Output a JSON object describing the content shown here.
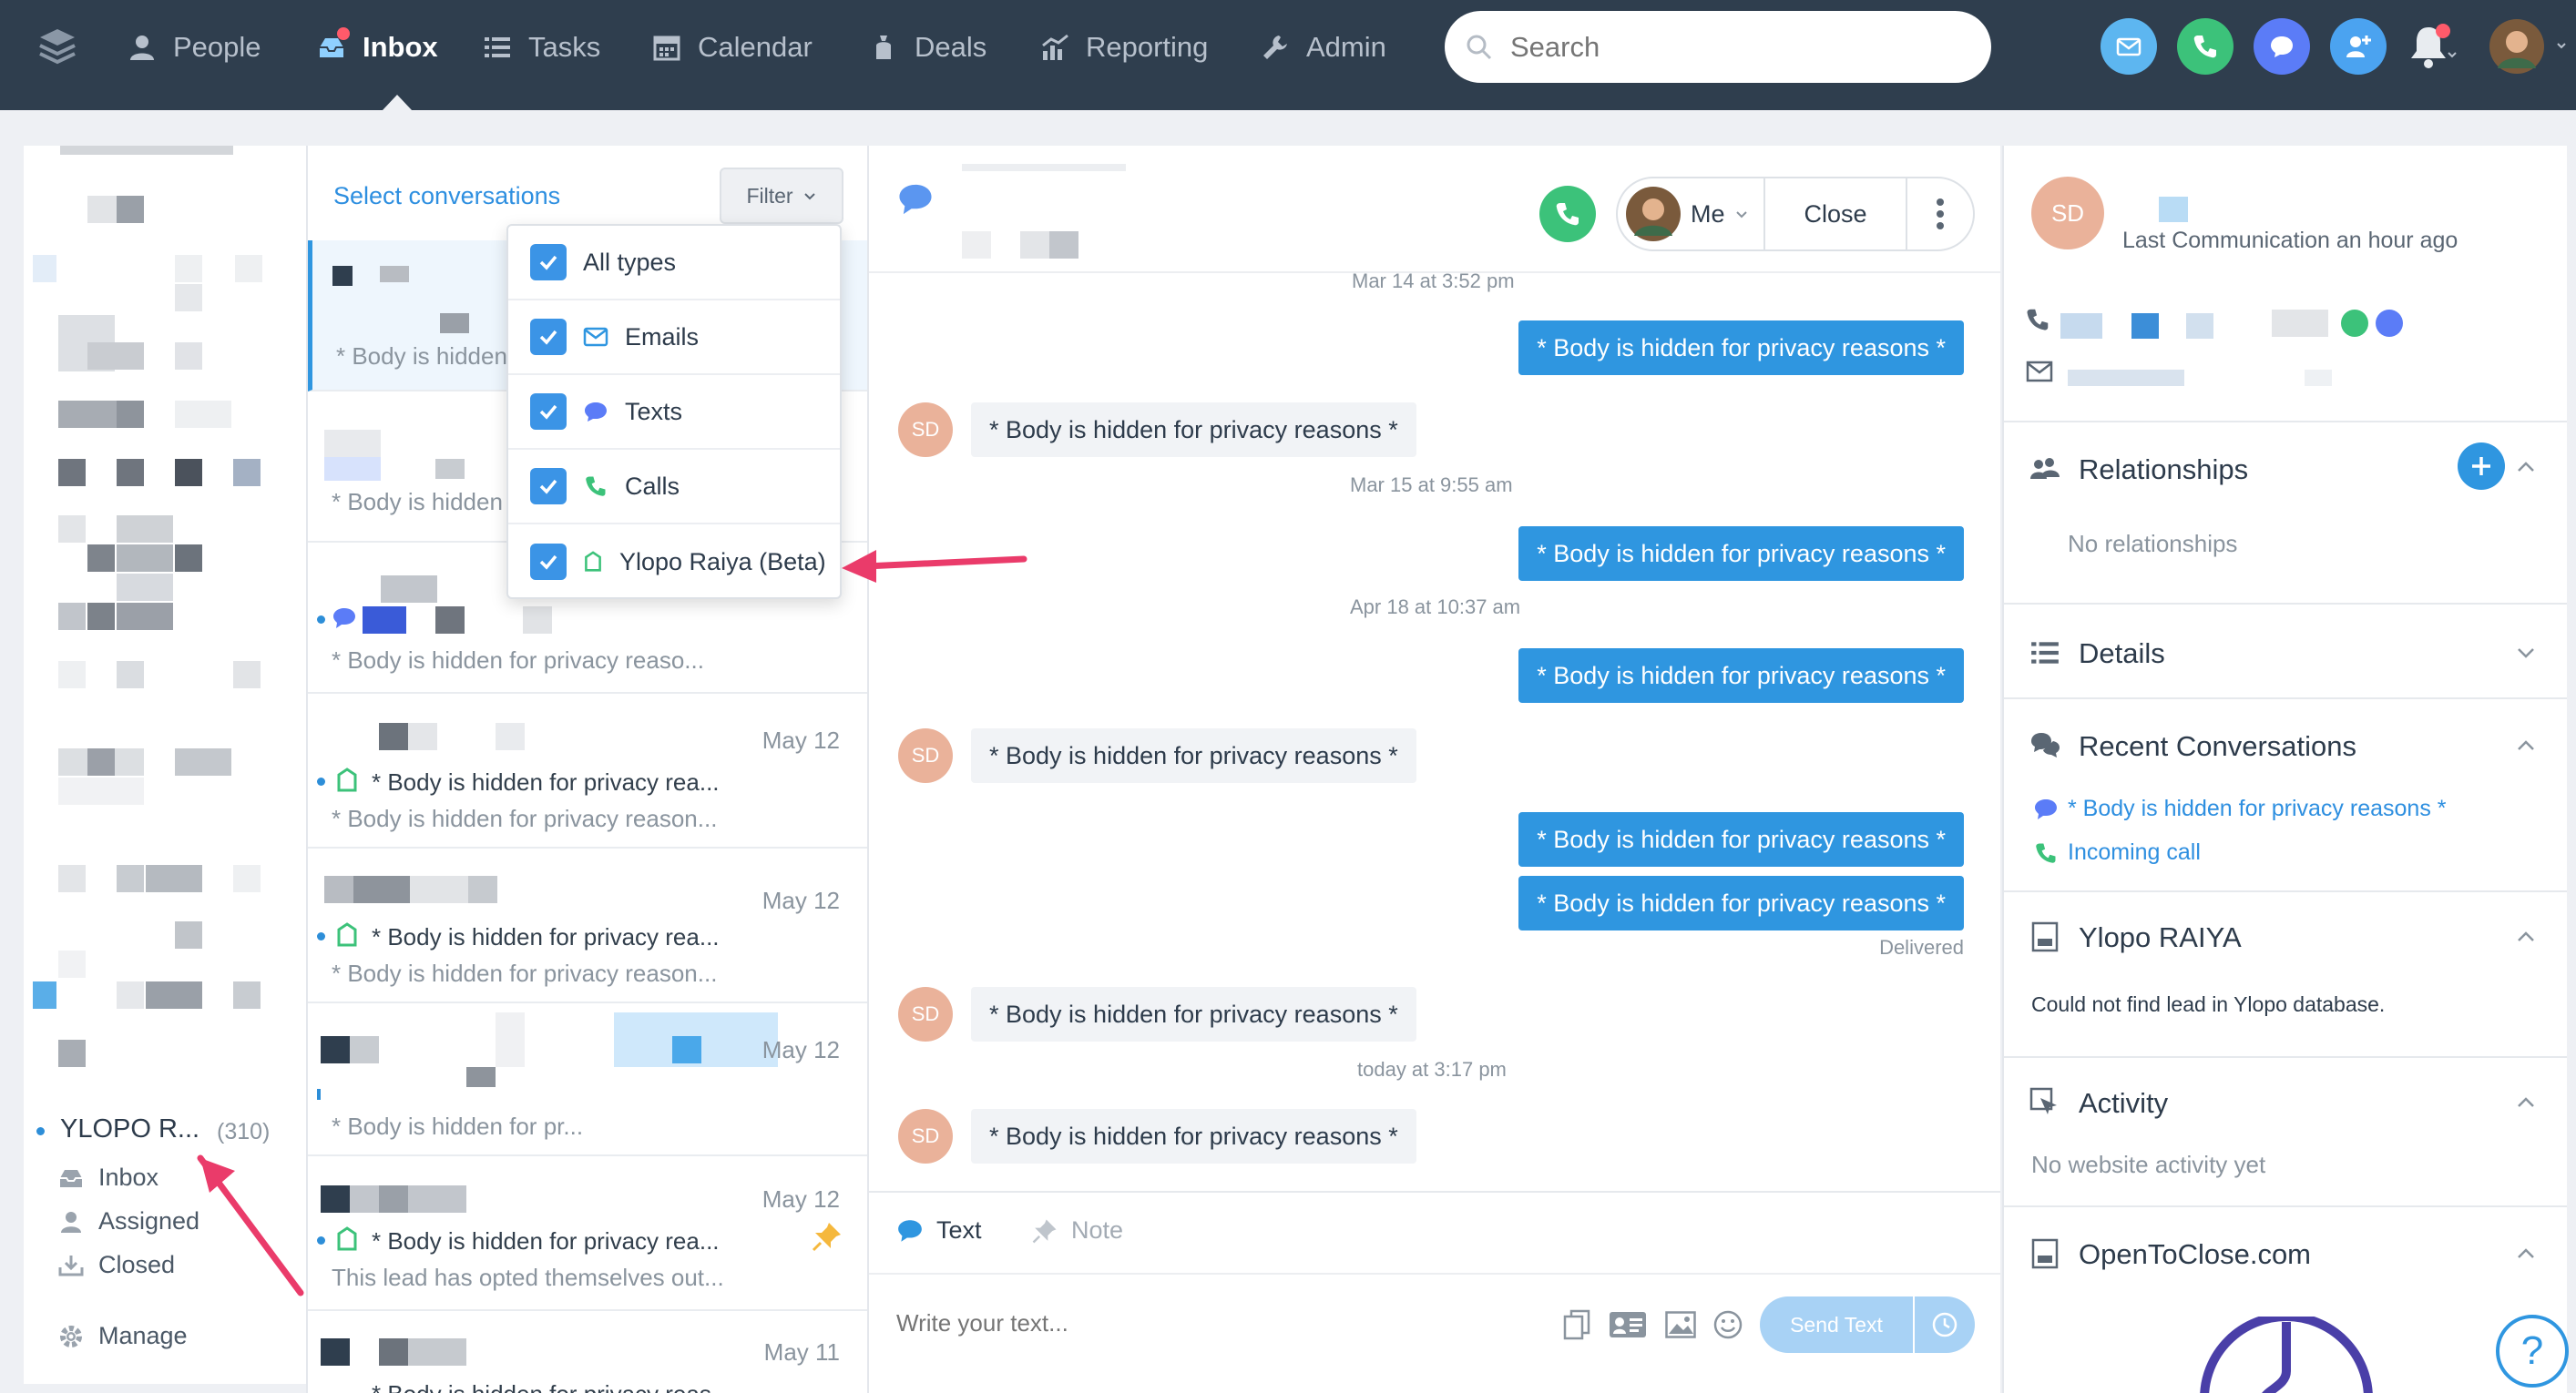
{
  "nav": {
    "items": [
      {
        "label": "People",
        "icon": "person-icon"
      },
      {
        "label": "Inbox",
        "icon": "inbox-icon"
      },
      {
        "label": "Tasks",
        "icon": "list-icon"
      },
      {
        "label": "Calendar",
        "icon": "calendar-icon"
      },
      {
        "label": "Deals",
        "icon": "money-bag-icon"
      },
      {
        "label": "Reporting",
        "icon": "chart-icon"
      },
      {
        "label": "Admin",
        "icon": "wrench-icon"
      }
    ],
    "active": "Inbox",
    "search_placeholder": "Search",
    "colors": {
      "bg": "#2f3e4e",
      "email": "#5db6f0",
      "phone": "#3cc27a",
      "chat": "#5b7cf7",
      "contact": "#4ba3f0"
    }
  },
  "sidebar": {
    "group_label": "YLOPO R...",
    "group_count": "(310)",
    "items": [
      {
        "label": "Inbox",
        "icon": "inbox-icon"
      },
      {
        "label": "Assigned",
        "icon": "person-icon"
      },
      {
        "label": "Closed",
        "icon": "download-tray-icon"
      }
    ],
    "manage_label": "Manage"
  },
  "conv_list": {
    "select_label": "Select conversations",
    "filter_label": "Filter",
    "rows": [
      {
        "date": "",
        "line1": "",
        "line2": "* Body is hidden"
      },
      {
        "date": "",
        "line1": "",
        "line2": "* Body is hidden"
      },
      {
        "date": "",
        "line1": "",
        "line2": "* Body is hidden for privacy reaso..."
      },
      {
        "date": "May 12",
        "line1": "* Body is hidden for privacy rea...",
        "line2": "* Body is hidden for privacy reason..."
      },
      {
        "date": "May 12",
        "line1": "* Body is hidden for privacy rea...",
        "line2": "* Body is hidden for privacy reason..."
      },
      {
        "date": "May 12",
        "line1": "",
        "line2": "* Body is hidden for pr..."
      },
      {
        "date": "May 12",
        "line1": "* Body is hidden for privacy rea...",
        "line2": "This lead has opted themselves out..."
      },
      {
        "date": "May 11",
        "line1": "* Body is hidden for privacy reas...",
        "line2": ""
      }
    ]
  },
  "filter_menu": {
    "items": [
      {
        "label": "All types",
        "icon": ""
      },
      {
        "label": "Emails",
        "icon": "envelope-icon"
      },
      {
        "label": "Texts",
        "icon": "chat-bubble-icon"
      },
      {
        "label": "Calls",
        "icon": "phone-icon"
      },
      {
        "label": "Ylopo Raiya (Beta)",
        "icon": "ylopo-icon"
      }
    ]
  },
  "chat": {
    "me_label": "Me",
    "close_label": "Close",
    "avatar_initials": "SD",
    "messages": [
      {
        "type": "time",
        "text": "Mar 14 at 3:52 pm"
      },
      {
        "type": "out",
        "text": "* Body is hidden for privacy reasons *"
      },
      {
        "type": "in",
        "text": "* Body is hidden for privacy reasons *"
      },
      {
        "type": "time",
        "text": "Mar 15 at 9:55 am"
      },
      {
        "type": "out",
        "text": "* Body is hidden for privacy reasons *"
      },
      {
        "type": "time",
        "text": "Apr 18 at 10:37 am"
      },
      {
        "type": "out",
        "text": "* Body is hidden for privacy reasons *"
      },
      {
        "type": "in",
        "text": "* Body is hidden for privacy reasons *"
      },
      {
        "type": "out",
        "text": "* Body is hidden for privacy reasons *"
      },
      {
        "type": "out",
        "text": "* Body is hidden for privacy reasons *"
      },
      {
        "type": "status",
        "text": "Delivered"
      },
      {
        "type": "in",
        "text": "* Body is hidden for privacy reasons *"
      },
      {
        "type": "time",
        "text": "today at 3:17 pm"
      },
      {
        "type": "in",
        "text": "* Body is hidden for privacy reasons *"
      }
    ],
    "composer": {
      "tab_text": "Text",
      "tab_note": "Note",
      "placeholder": "Write your text...",
      "send_label": "Send Text"
    }
  },
  "details": {
    "avatar_initials": "SD",
    "last_comm": "Last Communication an hour ago",
    "sections": {
      "relationships": {
        "title": "Relationships",
        "empty": "No relationships"
      },
      "details": {
        "title": "Details"
      },
      "recent": {
        "title": "Recent Conversations",
        "items": [
          "* Body is hidden for privacy reasons *",
          "Incoming call"
        ]
      },
      "ylopo": {
        "title": "Ylopo RAIYA",
        "text": "Could not find lead in Ylopo database."
      },
      "activity": {
        "title": "Activity",
        "empty": "No website activity yet"
      },
      "opentoclose": {
        "title": "OpenToClose.com"
      }
    }
  },
  "help_label": "?"
}
